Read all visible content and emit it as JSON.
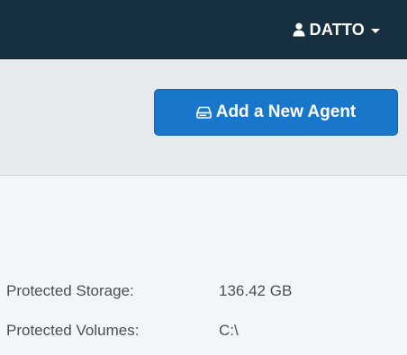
{
  "header": {
    "user_name": "DATTO",
    "user_icon": "user-icon",
    "dropdown_icon": "caret-down-icon"
  },
  "toolbar": {
    "add_agent_label": "Add a New Agent",
    "add_agent_icon": "hard-drive-icon"
  },
  "details": [
    {
      "label": "Protected Storage:",
      "value": "136.42 GB"
    },
    {
      "label": "Protected Volumes:",
      "value": "C:\\"
    }
  ],
  "colors": {
    "topbar": "#17303f",
    "primary_button": "#1877ca",
    "toolbar_bg": "#e8ebee",
    "content_bg": "#f3f6f9",
    "text": "#4a4f55"
  }
}
